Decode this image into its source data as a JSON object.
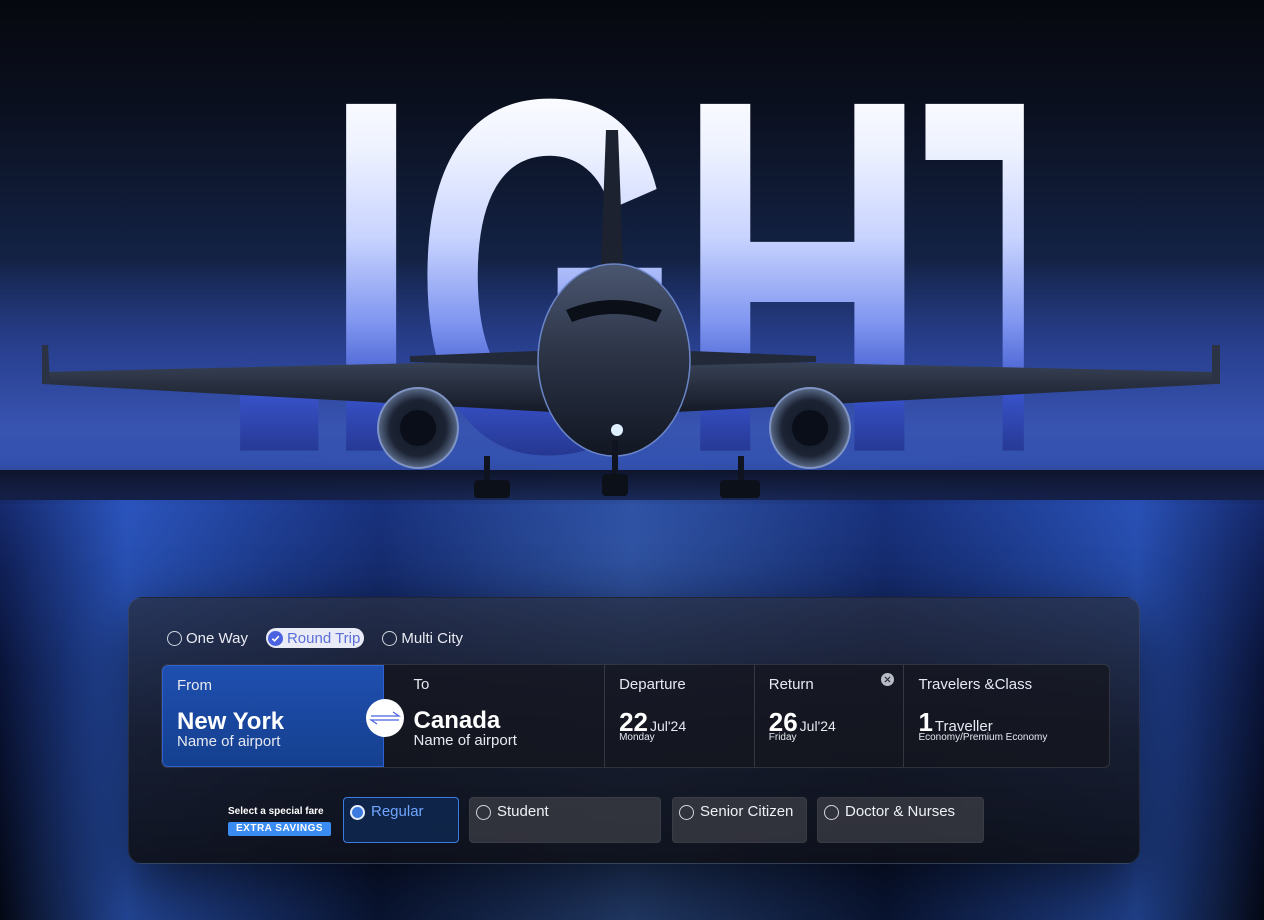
{
  "hero": {
    "headline": "FLIGHTS"
  },
  "trip_types": [
    {
      "label": "One Way",
      "selected": false
    },
    {
      "label": "Round Trip",
      "selected": true
    },
    {
      "label": "Multi City",
      "selected": false
    }
  ],
  "from": {
    "label": "From",
    "city": "New York",
    "airport": "Name of airport"
  },
  "to": {
    "label": "To",
    "city": "Canada",
    "airport": "Name of airport"
  },
  "departure": {
    "label": "Departure",
    "day": "22",
    "month": "Jul'24",
    "weekday": "Monday"
  },
  "return": {
    "label": "Return",
    "day": "26",
    "month": "Jul'24",
    "weekday": "Friday"
  },
  "travelers": {
    "label": "Travelers &Class",
    "count": "1",
    "word": "Traveller",
    "class": "Economy/Premium Economy"
  },
  "special_fare": {
    "label": "Select a special fare",
    "badge": "EXTRA SAVINGS",
    "options": [
      {
        "label": "Regular",
        "selected": true
      },
      {
        "label": "Student",
        "selected": false
      },
      {
        "label": "Senior Citizen",
        "selected": false
      },
      {
        "label": "Doctor & Nurses",
        "selected": false
      }
    ]
  },
  "colors": {
    "accent": "#3b7be0",
    "from_field": "#1f4fb0",
    "round_trip_check": "#4a62e0",
    "savings_badge": "#3a8cf2"
  },
  "icons": [
    "check-icon",
    "swap-icon",
    "clear-icon"
  ]
}
